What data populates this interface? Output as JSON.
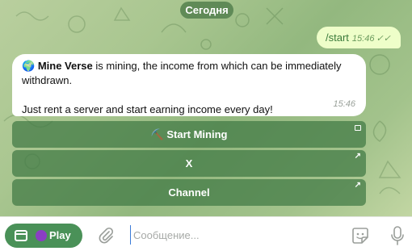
{
  "chat": {
    "date_separator": "Сегодня",
    "outgoing": {
      "text": "/start",
      "time": "15:46",
      "status_icon": "double-check-icon"
    },
    "incoming": {
      "globe_emoji": "🌍",
      "brand": "Mine Verse",
      "line1_rest": " is mining, the income from which can be immediately withdrawn.",
      "line2": "Just rent a server and start earning income every day!",
      "time": "15:46"
    },
    "keyboard": [
      {
        "label": "⛏️ Start Mining",
        "corner_icon": "web-app-icon"
      },
      {
        "label": "X",
        "corner_icon": "external-link-arrow-icon"
      },
      {
        "label": "Channel",
        "corner_icon": "external-link-arrow-icon"
      }
    ]
  },
  "composer": {
    "menu_button_label": "Play",
    "menu_button_emoji_color": "#8a3ec4",
    "placeholder": "Сообщение...",
    "icons": [
      "web-app-icon",
      "paperclip-icon",
      "sticker-icon",
      "microphone-icon"
    ]
  },
  "colors": {
    "accent_green": "#4a9158",
    "outgoing_bubble": "#eefec9",
    "keyboard_button": "#407844"
  }
}
